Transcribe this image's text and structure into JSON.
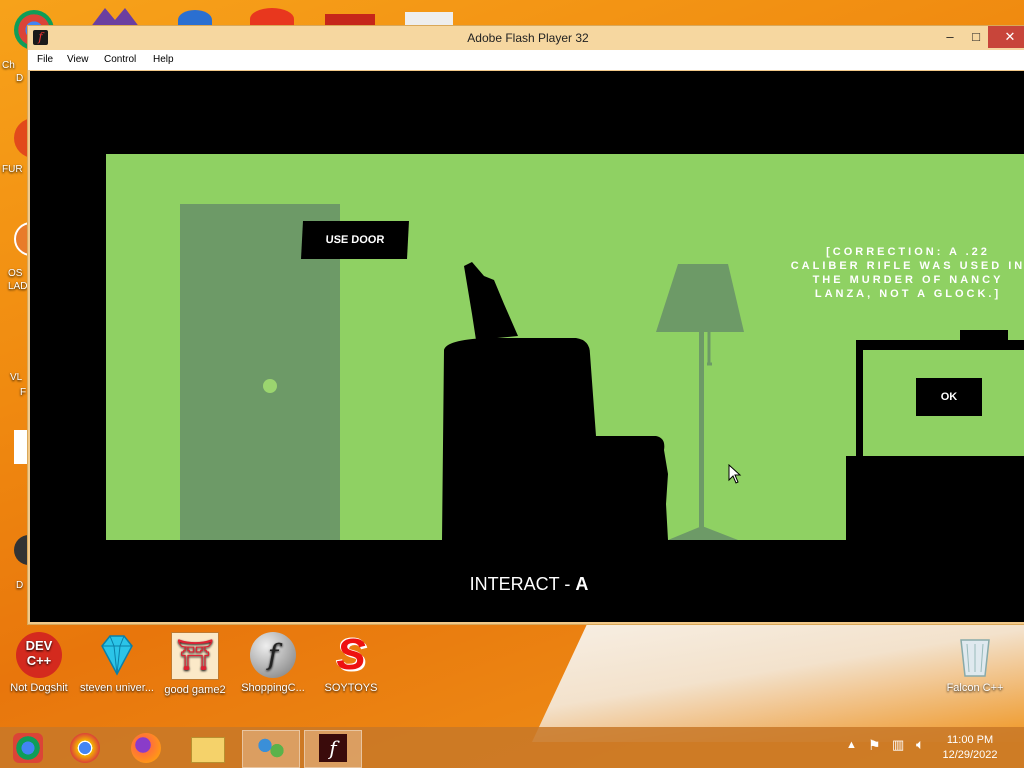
{
  "window": {
    "title": "Adobe Flash Player 32",
    "menu": [
      "File",
      "View",
      "Control",
      "Help"
    ],
    "minimize": "–",
    "maximize": "□",
    "close": "✕"
  },
  "game": {
    "use_door_label": "USE DOOR",
    "correction_text": "[CORRECTION: A .22 CALIBER RIFLE WAS USED IN THE MURDER OF NANCY LANZA, NOT A GLOCK.]",
    "ok_label": "OK",
    "interact_label": "INTERACT - ",
    "interact_key": "A",
    "colors": {
      "room": "#8fd163",
      "door": "#6d9a67",
      "lamp": "#6d9a67",
      "silhouette": "#000000"
    }
  },
  "desktop": {
    "left_edge_labels": [
      "Ch",
      "D",
      "FUR",
      "OS",
      "LAD",
      "VL",
      "F",
      "D"
    ],
    "icons": [
      {
        "label": "Not Dogshit",
        "icon": "dev-cpp-icon"
      },
      {
        "label": "steven univer...",
        "icon": "diamond-icon"
      },
      {
        "label": "good game2",
        "icon": "torii-icon"
      },
      {
        "label": "ShoppingC...",
        "icon": "flash-icon"
      },
      {
        "label": "SOYTOYS",
        "icon": "s-logo-icon"
      }
    ],
    "recycle_bin_label": "Falcon C++"
  },
  "taskbar": {
    "apps": [
      "chrome-old-icon",
      "chrome-icon",
      "firefox-icon",
      "file-explorer-icon",
      "network-people-icon",
      "flash-player-icon"
    ],
    "time": "11:00 PM",
    "date": "12/29/2022"
  }
}
